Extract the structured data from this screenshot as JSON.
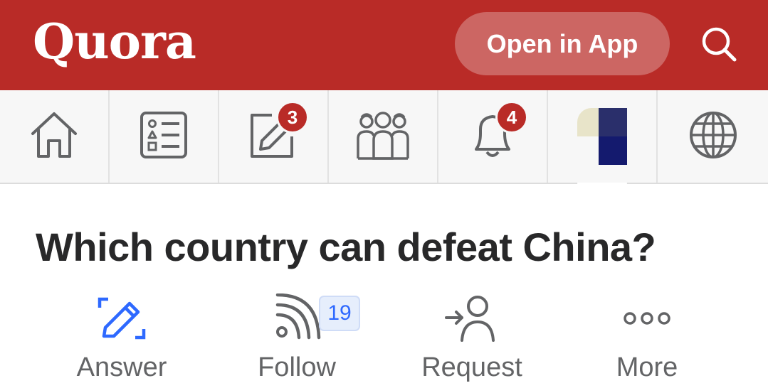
{
  "header": {
    "logo": "Quora",
    "open_app_label": "Open in App",
    "brand_color": "#b92b27"
  },
  "nav": {
    "items": [
      {
        "icon": "home-icon"
      },
      {
        "icon": "following-icon"
      },
      {
        "icon": "answer-icon",
        "badge": "3"
      },
      {
        "icon": "spaces-icon"
      },
      {
        "icon": "bell-icon",
        "badge": "4"
      },
      {
        "icon": "avatar"
      },
      {
        "icon": "globe-icon"
      }
    ]
  },
  "question": {
    "title": "Which country can defeat China?"
  },
  "actions": {
    "answer_label": "Answer",
    "follow_label": "Follow",
    "follow_count": "19",
    "request_label": "Request",
    "more_label": "More",
    "answer_color": "#2e69ff"
  }
}
